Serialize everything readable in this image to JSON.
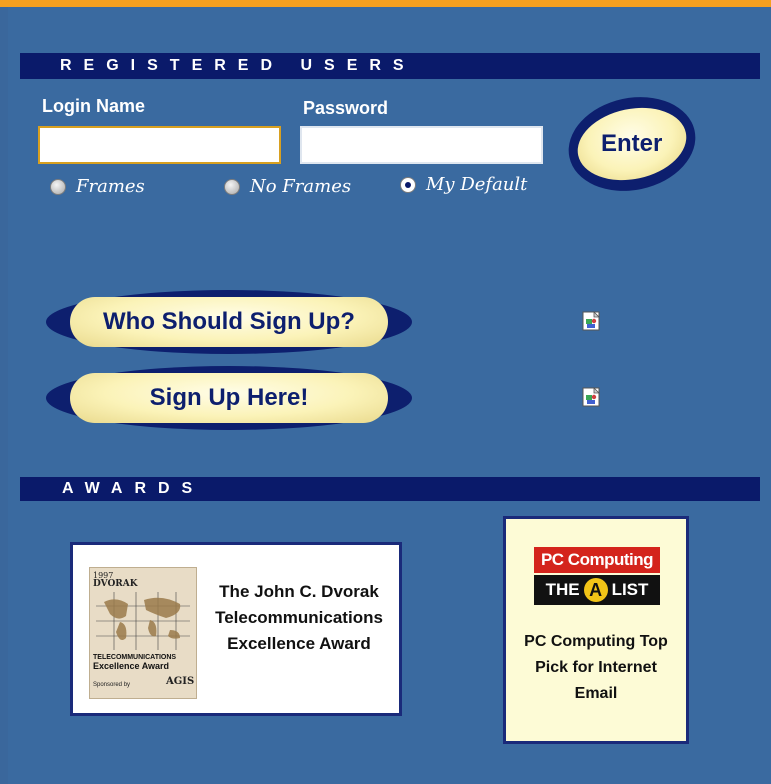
{
  "registered_section": {
    "title": "REGISTERED USERS"
  },
  "login": {
    "login_label": "Login Name",
    "password_label": "Password",
    "login_value": "",
    "password_value": "",
    "enter_label": "Enter"
  },
  "view_options": [
    {
      "label": "Frames",
      "selected": false
    },
    {
      "label": "No Frames",
      "selected": false
    },
    {
      "label": "My Default",
      "selected": true
    }
  ],
  "actions": {
    "who_signup_label": "Who Should Sign Up?",
    "signup_label": "Sign Up Here!"
  },
  "awards_section": {
    "title": "AWARDS"
  },
  "awards": {
    "dvorak": {
      "badge_year": "1997",
      "badge_name": "DVORAK",
      "badge_line1": "TELECOMMUNICATIONS",
      "badge_line2": "Excellence Award",
      "badge_sponsor": "Sponsored by ",
      "badge_logo": "AGIS",
      "title": "The John C. Dvorak Telecommunications Excellence Award"
    },
    "pc_computing": {
      "logo_top": "PC Computing",
      "logo_the": "THE",
      "logo_a": "A",
      "logo_list": "LIST",
      "title": "PC Computing Top Pick for Internet Email"
    }
  },
  "colors": {
    "background": "#3a6aa0",
    "top_bar": "#f5a020",
    "section_bar": "#0a1a6a",
    "button_fill": "#fbf3b8",
    "button_text": "#0d1f6e"
  }
}
